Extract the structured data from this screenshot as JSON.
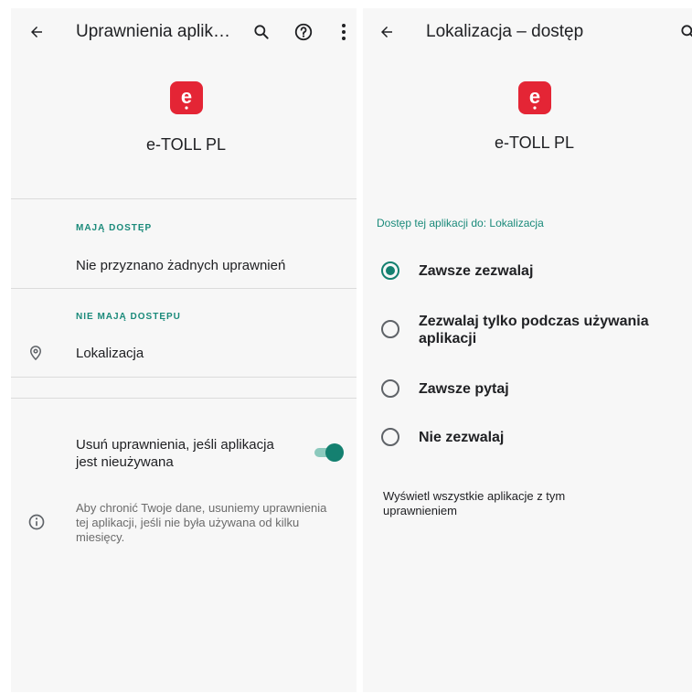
{
  "left_screen": {
    "toolbar": {
      "back_icon": "arrow-left-icon",
      "title": "Uprawnienia aplik…",
      "search_icon": "search-icon",
      "help_icon": "help-circle-icon",
      "more_icon": "more-vert-icon"
    },
    "app": {
      "icon_letter": "e",
      "icon_color": "#e42535",
      "name": "e-TOLL PL"
    },
    "allowed": {
      "label": "MAJĄ DOSTĘP",
      "item": "Nie przyznano żadnych uprawnień"
    },
    "denied": {
      "label": "NIE MAJĄ DOSTĘPU",
      "item_icon": "location-pin-icon",
      "item": "Lokalizacja"
    },
    "remove_permissions": {
      "label_line1": "Usuń uprawnienia, jeśli aplikacja",
      "label_line2": "jest nieużywana",
      "enabled": true
    },
    "info": {
      "icon": "info-icon",
      "line1": "Aby chronić Twoje dane, usuniemy uprawnienia",
      "line2": "tej aplikacji, jeśli nie była używana od kilku",
      "line3": "miesięcy."
    }
  },
  "right_screen": {
    "toolbar": {
      "back_icon": "arrow-left-icon",
      "title": "Lokalizacja – dostęp",
      "search_icon": "search-icon"
    },
    "app": {
      "icon_letter": "e",
      "icon_color": "#e42535",
      "name": "e-TOLL PL"
    },
    "access_header": "Dostęp tej aplikacji do: Lokalizacja",
    "options": [
      {
        "label": "Zawsze zezwalaj",
        "selected": true
      },
      {
        "label_line1": "Zezwalaj tylko podczas używania",
        "label_line2": "aplikacji",
        "selected": false
      },
      {
        "label": "Zawsze pytaj",
        "selected": false
      },
      {
        "label": "Nie zezwalaj",
        "selected": false
      }
    ],
    "footer": {
      "line1": "Wyświetl wszystkie aplikacje z tym",
      "line2": "uprawnieniem"
    }
  },
  "colors": {
    "accent": "#148070",
    "section_label": "#1a8a7a",
    "panel_background": "#f7f7f7"
  }
}
